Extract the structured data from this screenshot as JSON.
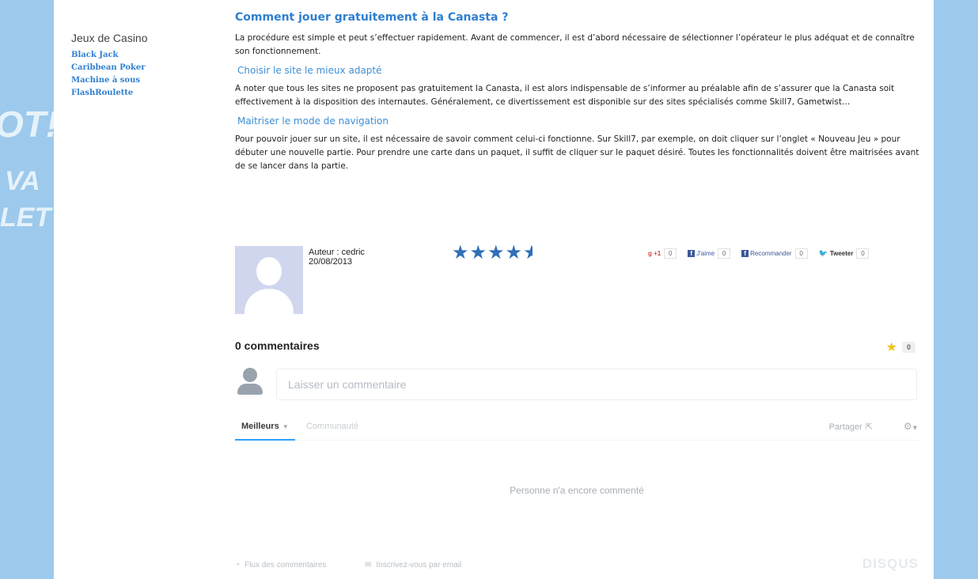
{
  "sidebar": {
    "heading": "Jeux de Casino",
    "links": [
      "Black Jack",
      "Caribbean Poker",
      "Machine à sous",
      "FlashRoulette"
    ]
  },
  "article": {
    "title": "Comment jouer gratuitement à la Canasta ?",
    "intro": "La procédure est simple et peut s’effectuer rapidement. Avant de commencer, il est d’abord nécessaire de sélectionner l’opérateur le plus adéquat et de connaître son fonctionnement.",
    "section1_title": "Choisir le site le mieux adapté",
    "section1_text": "A noter que tous les sites ne proposent pas gratuitement la Canasta, il est alors indispensable de s’informer au préalable afin de s’assurer que la Canasta soit effectivement à la disposition des internautes. Généralement, ce divertissement est disponible sur des sites spécialisés comme Skill7, Gametwist…",
    "section2_title": "Maitriser le mode de navigation",
    "section2_text": "Pour pouvoir jouer sur un site, il est nécessaire de savoir comment celui-ci fonctionne. Sur Skill7, par exemple, on doit cliquer sur l’onglet « Nouveau Jeu » pour débuter une nouvelle partie. Pour prendre une carte dans un paquet, il suffit de cliquer sur le paquet désiré. Toutes les fonctionnalités doivent être maitrisées avant de se lancer dans la partie."
  },
  "author": {
    "label": "Auteur : cedric",
    "date": "20/08/2013",
    "rating": 4.5,
    "rating_max": 5,
    "rating_color": "#2f6fb8"
  },
  "social": {
    "gplus_label": "+1",
    "gplus_count": "0",
    "like_label": "J'aime",
    "like_count": "0",
    "recommend_label": "Recommander",
    "recommend_count": "0",
    "tweet_label": "Tweeter",
    "tweet_count": "0"
  },
  "comments": {
    "count_label": "0 commentaires",
    "favorite_count": "0",
    "input_placeholder": "Laisser un commentaire",
    "tab_best": "Meilleurs",
    "tab_community": "Communauté",
    "share_label": "Partager",
    "empty_text": "Personne n'a encore commenté",
    "rss_label": "Flux des commentaires",
    "email_label": "Inscrivez-vous par email",
    "logo": "DISQUS",
    "accent": "#2e9fff"
  },
  "colors": {
    "link": "#2f7fd0",
    "side_band": "#9dc9ec"
  }
}
